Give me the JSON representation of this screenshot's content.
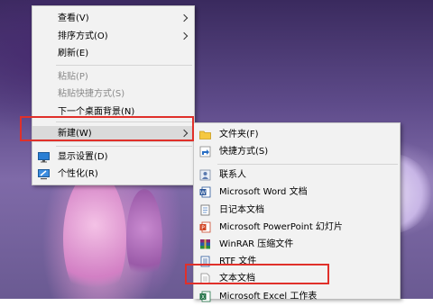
{
  "context_menu": {
    "items": [
      {
        "label": "查看(V)"
      },
      {
        "label": "排序方式(O)"
      },
      {
        "label": "刷新(E)"
      },
      {
        "label": "粘贴(P)"
      },
      {
        "label": "粘贴快捷方式(S)"
      },
      {
        "label": "下一个桌面背景(N)"
      },
      {
        "label": "新建(W)"
      },
      {
        "label": "显示设置(D)"
      },
      {
        "label": "个性化(R)"
      }
    ]
  },
  "submenu_new": {
    "items": [
      {
        "label": "文件夹(F)"
      },
      {
        "label": "快捷方式(S)"
      },
      {
        "label": "联系人"
      },
      {
        "label": "Microsoft Word 文档"
      },
      {
        "label": "日记本文档"
      },
      {
        "label": "Microsoft PowerPoint 幻灯片"
      },
      {
        "label": "WinRAR 压缩文件"
      },
      {
        "label": "RTF 文件"
      },
      {
        "label": "文本文档"
      },
      {
        "label": "Microsoft Excel 工作表"
      }
    ]
  },
  "colors": {
    "highlight_box": "#e0302a",
    "menu_background": "#f2f2f2",
    "hover_background": "#dadada"
  }
}
